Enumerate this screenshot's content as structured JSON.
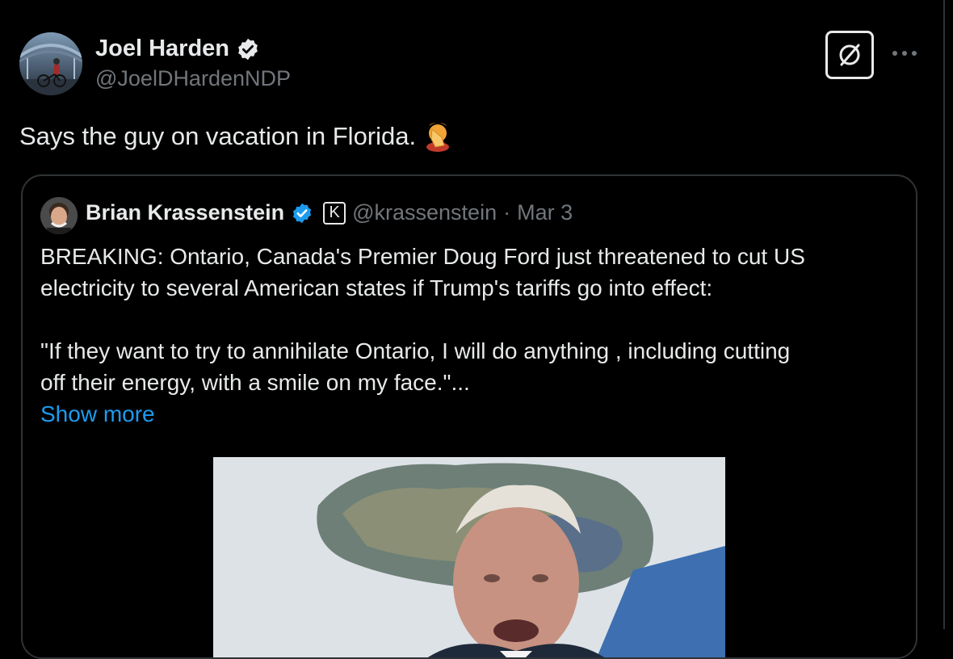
{
  "author": {
    "name": "Joel Harden",
    "handle": "@JoelDHardenNDP",
    "verified": true
  },
  "tweet": {
    "text": "Says the guy on vacation in Florida.",
    "emoji": "facepalm-emoji"
  },
  "quoted": {
    "name": "Brian Krassenstein",
    "badge_letter": "K",
    "handle": "@krassenstein",
    "separator": "·",
    "date": "Mar 3",
    "lines": [
      "BREAKING: Ontario, Canada's Premier Doug Ford just threatened to cut US",
      "electricity to several American states if Trump's tariffs go into effect:",
      "",
      "\"If they want to try to annihilate Ontario, I will do anything , including cutting",
      "off their energy, with a smile on my face.\"..."
    ],
    "show_more": "Show more"
  },
  "colors": {
    "background": "#000000",
    "text": "#e7e9ea",
    "muted": "#71767b",
    "link": "#1d9bf0",
    "verified": "#1d9bf0",
    "border": "#2f3336"
  },
  "icons": {
    "grok": "grok-icon",
    "more": "more-dots-icon",
    "verified": "verified-badge-icon"
  }
}
